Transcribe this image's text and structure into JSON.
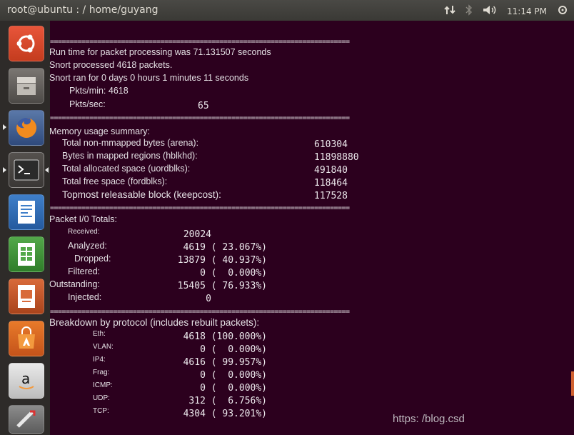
{
  "window": {
    "title": "root@ubuntu : / home/guyang"
  },
  "panel": {
    "clock": "11:14 PM",
    "icons": [
      "network-icon",
      "bluetooth-icon",
      "volume-icon",
      "power-gear-icon"
    ]
  },
  "launcher": {
    "items": [
      "ubuntu-dash",
      "files",
      "firefox",
      "terminal",
      "libreoffice-writer",
      "libreoffice-calc",
      "libreoffice-impress",
      "software-center",
      "amazon",
      "system-settings"
    ]
  },
  "separator": "============================================================================",
  "runtime": {
    "line1": "Run time for packet processing was 71.131507 seconds",
    "line2": "Snort processed 4618 packets.",
    "line3": "Snort ran for 0 days 0 hours 1 minutes 11 seconds",
    "pkts_min": "Pkts/min: 4618",
    "pkts_sec_label": "Pkts/sec:",
    "pkts_sec_value": "65"
  },
  "memory": {
    "header": "Memory usage summary:",
    "rows": [
      {
        "label": "Total non-mmapped bytes (arena):",
        "value": "610304"
      },
      {
        "label": "Bytes in mapped regions (hblkhd):",
        "value": "11898880"
      },
      {
        "label": "Total allocated space (uordblks):",
        "value": "491840"
      },
      {
        "label": "Total free space (fordblks):",
        "value": "118464"
      },
      {
        "label": "Topmost releasable block (keepcost):",
        "value": "117528"
      }
    ]
  },
  "packet_io": {
    "header": "Packet I/0 Totals:",
    "rows": [
      {
        "label": "Received:",
        "value": "20024"
      },
      {
        "label": "Analyzed:",
        "value": "4619 ( 23.067%)"
      },
      {
        "label": "Dropped:",
        "value": "13879 ( 40.937%)"
      },
      {
        "label": "Filtered:",
        "value": "0 (  0.000%)"
      },
      {
        "label": "Outstanding:",
        "value": "15405 ( 76.933%)"
      },
      {
        "label": "Injected:",
        "value": "0"
      }
    ]
  },
  "protocol": {
    "header": "Breakdown by protocol (includes rebuilt packets):",
    "rows": [
      {
        "label": "Eth:",
        "value": "4618 (100.000%)"
      },
      {
        "label": "VLAN:",
        "value": "0 (  0.000%)"
      },
      {
        "label": "IP4:",
        "value": "4616 ( 99.957%)"
      },
      {
        "label": "Frag:",
        "value": "0 (  0.000%)"
      },
      {
        "label": "ICMP:",
        "value": "0 (  0.000%)"
      },
      {
        "label": "UDP:",
        "value": "312 (  6.756%)"
      },
      {
        "label": "TCP:",
        "value": "4304 ( 93.201%)"
      }
    ]
  },
  "watermark": "https: /blog.csd"
}
